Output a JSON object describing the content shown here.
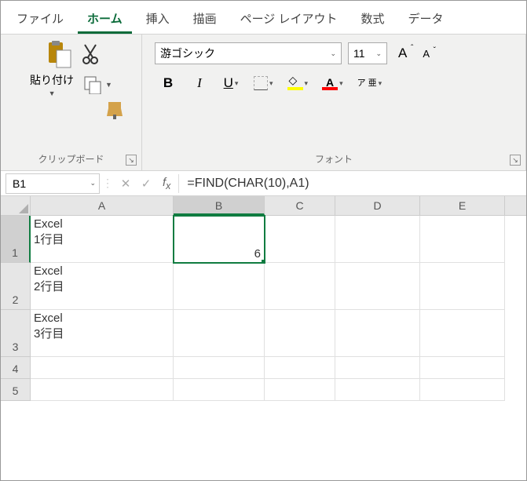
{
  "tabs": [
    "ファイル",
    "ホーム",
    "挿入",
    "描画",
    "ページ レイアウト",
    "数式",
    "データ"
  ],
  "active_tab": 1,
  "clipboard": {
    "paste": "貼り付け",
    "group": "クリップボード"
  },
  "font": {
    "name": "游ゴシック",
    "size": "11",
    "bold": "B",
    "italic": "I",
    "underline": "U",
    "ruby": "ア\n亜",
    "group": "フォント"
  },
  "namebox": "B1",
  "formula": "=FIND(CHAR(10),A1)",
  "columns": [
    "A",
    "B",
    "C",
    "D",
    "E"
  ],
  "selected_col": "B",
  "selected_row": 1,
  "rows": [
    {
      "n": 1,
      "h": "tall",
      "cells": [
        "Excel\n1行目",
        "6",
        "",
        "",
        ""
      ]
    },
    {
      "n": 2,
      "h": "tall",
      "cells": [
        "Excel\n2行目",
        "",
        "",
        "",
        ""
      ]
    },
    {
      "n": 3,
      "h": "tall",
      "cells": [
        "Excel\n3行目",
        "",
        "",
        "",
        ""
      ]
    },
    {
      "n": 4,
      "h": "short",
      "cells": [
        "",
        "",
        "",
        "",
        ""
      ]
    },
    {
      "n": 5,
      "h": "short",
      "cells": [
        "",
        "",
        "",
        "",
        ""
      ]
    }
  ]
}
